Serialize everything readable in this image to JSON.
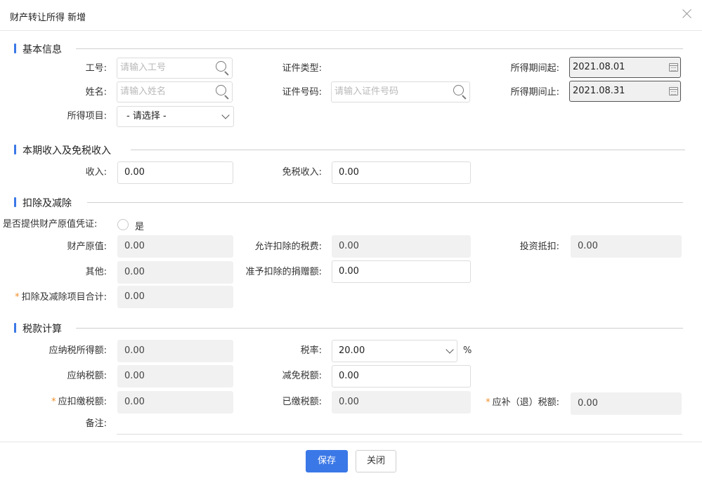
{
  "dialog": {
    "title": "财产转让所得 新增"
  },
  "sections": {
    "basic": "基本信息",
    "income": "本期收入及免税收入",
    "deduction": "扣除及减除",
    "tax": "税款计算"
  },
  "basic": {
    "employee_id_label": "工号:",
    "employee_id_placeholder": "请输入工号",
    "name_label": "姓名:",
    "name_placeholder": "请输入姓名",
    "income_item_label": "所得项目:",
    "income_item_value": "- 请选择 -",
    "id_type_label": "证件类型:",
    "id_number_label": "证件号码:",
    "id_number_placeholder": "请输入证件号码",
    "period_start_label": "所得期间起:",
    "period_start_value": "2021.08.01",
    "period_end_label": "所得期间止:",
    "period_end_value": "2021.08.31"
  },
  "income": {
    "income_label": "收入:",
    "income_value": "0.00",
    "tax_free_label": "免税收入:",
    "tax_free_value": "0.00"
  },
  "deduction": {
    "proof_label": "是否提供财产原值凭证:",
    "proof_option": "是",
    "original_value_label": "财产原值:",
    "original_value": "0.00",
    "allowed_tax_label": "允许扣除的税费:",
    "allowed_tax_value": "0.00",
    "investment_label": "投资抵扣:",
    "investment_value": "0.00",
    "other_label": "其他:",
    "other_value": "0.00",
    "donation_label": "准予扣除的捐赠额:",
    "donation_value": "0.00",
    "total_label": "扣除及减除项目合计:",
    "total_value": "0.00",
    "required_mark": "*"
  },
  "tax": {
    "taxable_income_label": "应纳税所得额:",
    "taxable_income_value": "0.00",
    "rate_label": "税率:",
    "rate_value": "20.00",
    "rate_unit": "%",
    "tax_payable_label": "应纳税额:",
    "tax_payable_value": "0.00",
    "reduction_label": "减免税额:",
    "reduction_value": "0.00",
    "withholding_label": "应扣缴税额:",
    "withholding_value": "0.00",
    "paid_label": "已缴税额:",
    "paid_value": "0.00",
    "refund_label": "应补（退）税额:",
    "refund_value": "0.00",
    "remarks_label": "备注:",
    "required_mark": "*"
  },
  "buttons": {
    "save": "保存",
    "close": "关闭"
  },
  "colors": {
    "accent": "#3b78e7",
    "required": "#f2902b",
    "disabled_bg": "#f1f1f1"
  }
}
